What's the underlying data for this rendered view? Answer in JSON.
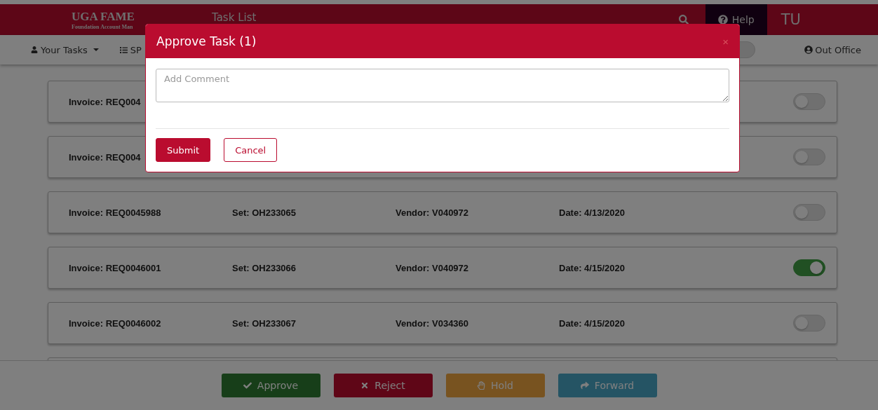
{
  "header": {
    "brand": "UGA FAME",
    "brand_subtitle": "Foundation Account Man",
    "page_title": "Task List",
    "help": "Help",
    "user": "TU"
  },
  "subnav": {
    "items": [
      {
        "kind": "menu",
        "label": "Your Tasks"
      },
      {
        "kind": "link",
        "label": "SP"
      }
    ],
    "toggle_on": false,
    "out_office": "Out Office"
  },
  "tasks": [
    {
      "invoice": "Invoice: REQ004",
      "selected": false
    },
    {
      "invoice": "Invoice: REQ004",
      "selected": false
    },
    {
      "invoice": "Invoice: REQ0045988",
      "set": "Set: OH233065",
      "vendor": "Vendor: V040972",
      "date": "Date: 4/13/2020",
      "selected": false
    },
    {
      "invoice": "Invoice: REQ0046001",
      "set": "Set: OH233066",
      "vendor": "Vendor: V040972",
      "date": "Date: 4/15/2020",
      "selected": true
    },
    {
      "invoice": "Invoice: REQ0046002",
      "set": "Set: OH233067",
      "vendor": "Vendor: V034360",
      "date": "Date: 4/15/2020",
      "selected": false
    }
  ],
  "actions": [
    {
      "kind": "approve",
      "label": "Approve"
    },
    {
      "kind": "reject",
      "label": "Reject"
    },
    {
      "kind": "hold",
      "label": "Hold"
    },
    {
      "kind": "forward",
      "label": "Forward"
    }
  ],
  "modal": {
    "title": "Approve Task (1)",
    "close": "×",
    "placeholder": "Add Comment",
    "submit": "Submit",
    "cancel": "Cancel"
  }
}
